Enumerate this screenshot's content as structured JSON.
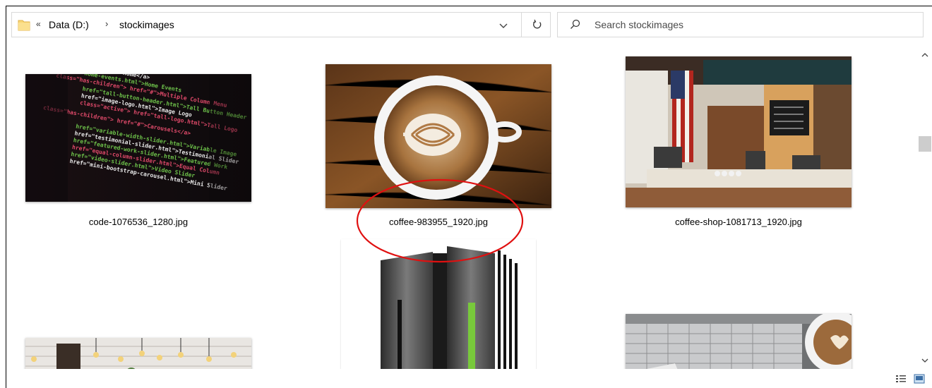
{
  "address_bar": {
    "back_glyph": "«",
    "crumbs": [
      "Data (D:)",
      "stockimages"
    ],
    "separator": "›",
    "dropdown_icon": "chevron-down-icon",
    "refresh_icon": "refresh-icon"
  },
  "search": {
    "placeholder": "Search stockimages",
    "icon": "search-icon"
  },
  "files": [
    {
      "name": "code-1076536_1280.jpg",
      "preview": "code"
    },
    {
      "name": "coffee-983955_1920.jpg",
      "preview": "latte"
    },
    {
      "name": "coffee-shop-1081713_1920.jpg",
      "preview": "coffee-shop"
    },
    {
      "name": "",
      "preview": "server"
    },
    {
      "name": "",
      "preview": "cafe-lights"
    },
    {
      "name": "",
      "preview": "laptop-coffee"
    }
  ],
  "annotation": {
    "shape": "ellipse",
    "color": "#e01010"
  },
  "view_buttons": [
    "details-view-icon",
    "large-icons-view-icon"
  ]
}
